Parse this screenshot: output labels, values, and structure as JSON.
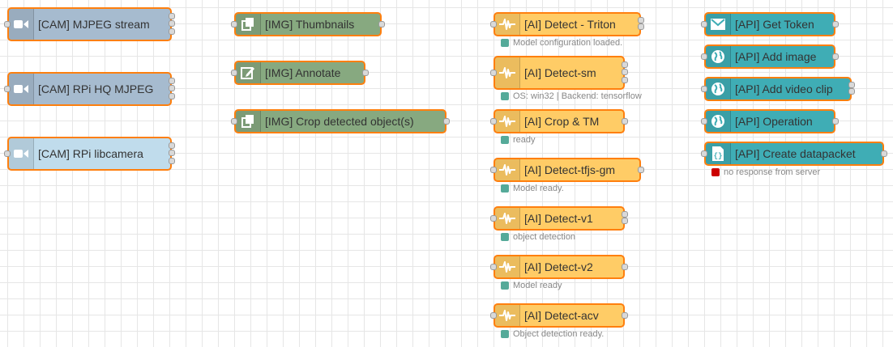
{
  "colors": {
    "cam": "#a6bbcf",
    "cam_light": "#c0dcec",
    "img": "#87a980",
    "ai": "#ffcc66",
    "api": "#3fadb5",
    "node_border": "#ff7f0e",
    "status_ok": "#5a9",
    "status_error": "#c00"
  },
  "nodes": {
    "cam_mjpeg": {
      "label": "[CAM] MJPEG stream",
      "icon": "video-camera-icon"
    },
    "cam_rpi_hq": {
      "label": "[CAM] RPi HQ MJPEG",
      "icon": "video-camera-icon"
    },
    "cam_libcamera": {
      "label": "[CAM] RPi libcamera",
      "icon": "video-camera-icon"
    },
    "img_thumbnails": {
      "label": "[IMG] Thumbnails",
      "icon": "image-stack-icon"
    },
    "img_annotate": {
      "label": "[IMG] Annotate",
      "icon": "edit-icon"
    },
    "img_crop": {
      "label": "[IMG] Crop detected object(s)",
      "icon": "image-stack-icon"
    },
    "ai_triton": {
      "label": "[AI] Detect - Triton",
      "icon": "waveform-icon",
      "status": "Model configuration loaded."
    },
    "ai_sm": {
      "label": "[AI] Detect-sm",
      "icon": "waveform-icon",
      "status": "OS: win32 | Backend: tensorflow"
    },
    "ai_crop_tm": {
      "label": "[AI] Crop & TM",
      "icon": "waveform-icon",
      "status": "ready"
    },
    "ai_tfjs": {
      "label": "[AI] Detect-tfjs-gm",
      "icon": "waveform-icon",
      "status": "Model ready."
    },
    "ai_v1": {
      "label": "[AI] Detect-v1",
      "icon": "waveform-icon",
      "status": "object detection"
    },
    "ai_v2": {
      "label": "[AI] Detect-v2",
      "icon": "waveform-icon",
      "status": "Model ready"
    },
    "ai_acv": {
      "label": "[AI] Detect-acv",
      "icon": "waveform-icon",
      "status": "Object detection ready."
    },
    "api_token": {
      "label": "[API] Get Token",
      "icon": "envelope-icon"
    },
    "api_add_image": {
      "label": "[API] Add image",
      "icon": "globe-icon"
    },
    "api_add_video": {
      "label": "[API] Add video clip",
      "icon": "globe-icon"
    },
    "api_operation": {
      "label": "[API] Operation",
      "icon": "globe-icon"
    },
    "api_datapacket": {
      "label": "[API] Create datapacket",
      "icon": "json-file-icon",
      "status": "no response from server"
    }
  }
}
